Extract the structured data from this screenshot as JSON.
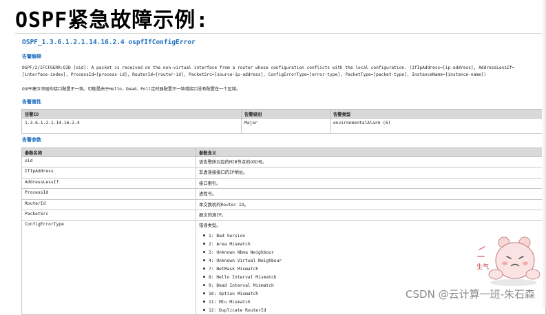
{
  "slide": {
    "title": "OSPF紧急故障示例:"
  },
  "alarm": {
    "heading": "OSPF_1.3.6.1.2.1.14.16.2.4 ospfIfConfigError",
    "explanation_label": "告警解释",
    "explanation_en": "OSPF/2/IFCFGERR:OID [oid]: A packet is received on the non-virtual interface from a router whose configuration conflicts with the local configuration. (IfIpAddress=[ip-address], AddressLessIf=[interface-index], ProcessId=[process-id], RouterId=[router-id], PacketSrc=[source-ip-address], ConfigErrorType=[error-type], PacketType=[packet-type], InstanceName=[instance-name])",
    "explanation_cn": "OSPF建立邻居的接口配置不一致。可能是由于Hello、Dead、Poll定时器配置不一致或接口没有配置在一个区域。",
    "attributes_label": "告警属性",
    "attributes_headers": [
      "告警ID",
      "告警级别",
      "告警类型"
    ],
    "attributes_row": [
      "1.3.6.1.2.1.14.16.2.4",
      "Major",
      "environmentalAlarm (6)"
    ],
    "params_label": "告警参数",
    "params_headers": [
      "参数名称",
      "参数含义"
    ],
    "params_rows": [
      {
        "name": "oid",
        "meaning": "该告警所对应的MIB节点的OID号。"
      },
      {
        "name": "IfIpAddress",
        "meaning": "非虚连接接口的IP地址。"
      },
      {
        "name": "AddressLessIf",
        "meaning": "接口索引。"
      },
      {
        "name": "ProcessId",
        "meaning": "进程号。"
      },
      {
        "name": "RouterId",
        "meaning": "本交换机的Router ID。"
      },
      {
        "name": "PacketSrc",
        "meaning": "报文的源IP。"
      },
      {
        "name": "ConfigErrorType",
        "meaning": "错误类型。"
      }
    ],
    "error_types": [
      "1: Bad Version",
      "2: Area Mismatch",
      "3: Unknown Nbma Neighbour",
      "4: Unknown Virtual Neighbour",
      "7: NetMask Mismatch",
      "8: Hello Interval Mismatch",
      "9: Dead Interval Mismatch",
      "10: Option Mismatch",
      "11: Mtu Mismatch",
      "12: Duplicate RouterId"
    ]
  },
  "watermark": "CSDN @云计算一班-朱石森",
  "sticker_text": "生气"
}
